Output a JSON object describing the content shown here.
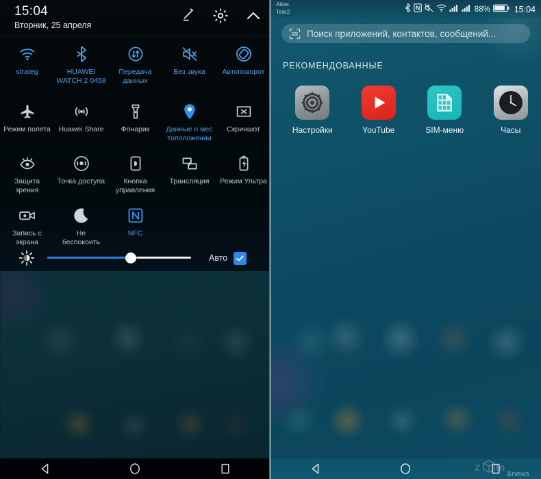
{
  "left_panel": {
    "header": {
      "time": "15:04",
      "date": "Вторник, 25 апреля",
      "icons": [
        "edit-pencil-icon",
        "gear-icon",
        "collapse-chevron-up-icon"
      ]
    },
    "toggles": [
      [
        {
          "icon": "wifi-icon",
          "label": "strateg",
          "state": "on"
        },
        {
          "icon": "bluetooth-icon",
          "label": "HUAWEI\nWATCH 2 0458",
          "state": "on"
        },
        {
          "icon": "data-transfer-icon",
          "label": "Передача\nданных",
          "state": "on"
        },
        {
          "icon": "mute-icon",
          "label": "Без звука",
          "state": "on"
        },
        {
          "icon": "auto-rotate-icon",
          "label": "Автоповорот",
          "state": "on"
        }
      ],
      [
        {
          "icon": "airplane-icon",
          "label": "Режим полета",
          "state": "off"
        },
        {
          "icon": "huawei-share-icon",
          "label": "Huawei Share",
          "state": "off"
        },
        {
          "icon": "flashlight-icon",
          "label": "Фонарик",
          "state": "off"
        },
        {
          "icon": "location-pin-icon",
          "label": "Данные о мес\nтоположении",
          "state": "active"
        },
        {
          "icon": "screenshot-icon",
          "label": "Скриншот",
          "state": "off"
        }
      ],
      [
        {
          "icon": "eye-protection-icon",
          "label": "Защита\nзрения",
          "state": "off"
        },
        {
          "icon": "hotspot-icon",
          "label": "Точка доступа",
          "state": "off"
        },
        {
          "icon": "floating-button-icon",
          "label": "Кнопка\nуправления",
          "state": "off"
        },
        {
          "icon": "cast-icon",
          "label": "Трансляция",
          "state": "off"
        },
        {
          "icon": "ultra-power-icon",
          "label": "Режим Ультра",
          "state": "off"
        }
      ],
      [
        {
          "icon": "screen-record-icon",
          "label": "Запись с\nэкрана",
          "state": "off"
        },
        {
          "icon": "do-not-disturb-moon-icon",
          "label": "Не\nбеспокоить",
          "state": "off"
        },
        {
          "icon": "nfc-icon",
          "label": "NFC",
          "state": "active"
        }
      ]
    ],
    "brightness": {
      "icon": "brightness-sun-icon",
      "value_percent": 58,
      "auto_label": "Авто",
      "auto_checked": true
    },
    "navbar": [
      "back-triangle-icon",
      "home-circle-icon",
      "recents-square-icon"
    ]
  },
  "right_panel": {
    "statusbar": {
      "carrier_line1": "Atlas",
      "carrier_line2": "Tele2",
      "icons": [
        "bluetooth-icon",
        "nfc-icon",
        "mute-icon",
        "wifi-icon",
        "signal-sim1-icon",
        "signal-sim2-icon"
      ],
      "battery_percent": "88%",
      "battery_icon": "battery-icon",
      "time": "15:04"
    },
    "search": {
      "icon": "scan-qr-icon",
      "placeholder": "Поиск приложений, контактов, сообщений..."
    },
    "section_title": "РЕКОМЕНДОВАННЫЕ",
    "apps": [
      {
        "label": "Настройки",
        "icon": "settings-gear-app-icon"
      },
      {
        "label": "YouTube",
        "icon": "youtube-play-app-icon"
      },
      {
        "label": "SIM-меню",
        "icon": "sim-menu-app-icon"
      },
      {
        "label": "Часы",
        "icon": "clock-app-icon"
      }
    ],
    "navbar": [
      "back-triangle-icon",
      "home-circle-icon",
      "recents-square-icon"
    ],
    "watermark": "zoom news"
  },
  "colors": {
    "accent_blue": "#4a9fe8",
    "slider_blue": "#2f7fe0",
    "checkbox_blue": "#2f89e8",
    "inactive_label": "#b9c4cc",
    "left_bg": "#03090c",
    "right_bg": "#0d4a60"
  }
}
